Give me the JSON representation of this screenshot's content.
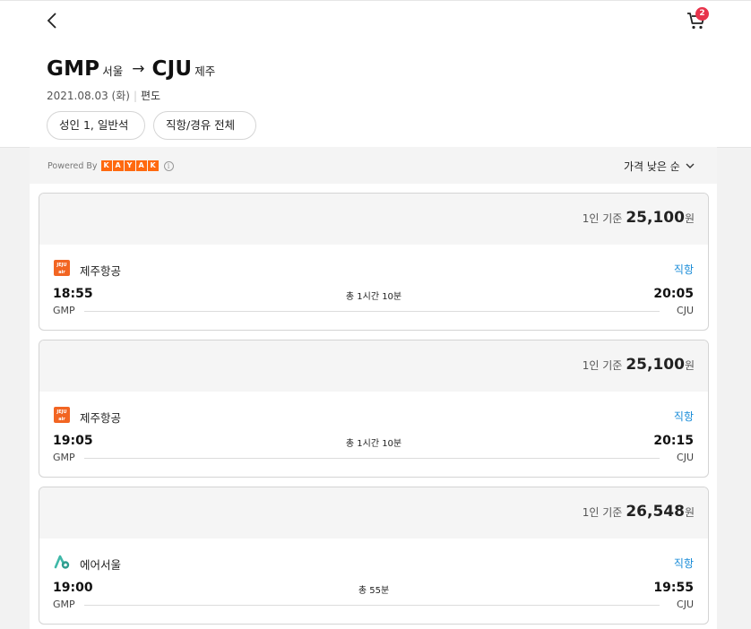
{
  "header": {
    "cart_count": "2",
    "origin_code": "GMP",
    "origin_city": "서울",
    "arrow": "→",
    "dest_code": "CJU",
    "dest_city": "제주",
    "date": "2021.08.03 (화)",
    "separator": "|",
    "trip_type": "편도"
  },
  "filters": {
    "passengers": "성인 1, 일반석",
    "stops": "직항/경유 전체"
  },
  "results": {
    "powered_by": "Powered By",
    "kayak_letters": [
      "K",
      "A",
      "Y",
      "A",
      "K"
    ],
    "info": "i",
    "sort_label": "가격 낮은 순"
  },
  "flights": [
    {
      "price_basis": "1인 기준",
      "price": "25,100",
      "currency": "원",
      "airline": "제주항공",
      "airline_logo_text": "JEJU air",
      "stops": "직항",
      "dep_time": "18:55",
      "arr_time": "20:05",
      "duration": "총 1시간 10분",
      "dep_code": "GMP",
      "arr_code": "CJU"
    },
    {
      "price_basis": "1인 기준",
      "price": "25,100",
      "currency": "원",
      "airline": "제주항공",
      "airline_logo_text": "JEJU air",
      "stops": "직항",
      "dep_time": "19:05",
      "arr_time": "20:15",
      "duration": "총 1시간 10분",
      "dep_code": "GMP",
      "arr_code": "CJU"
    },
    {
      "price_basis": "1인 기준",
      "price": "26,548",
      "currency": "원",
      "airline": "에어서울",
      "stops": "직항",
      "dep_time": "19:00",
      "arr_time": "19:55",
      "duration": "총 55분",
      "dep_code": "GMP",
      "arr_code": "CJU"
    }
  ],
  "colors": {
    "accent_blue": "#1a8cd8",
    "badge_red": "#e8334b",
    "kayak_orange": "#ff690f",
    "jeju_orange": "#f26522",
    "airseoul_teal": "#3fb8a8"
  }
}
